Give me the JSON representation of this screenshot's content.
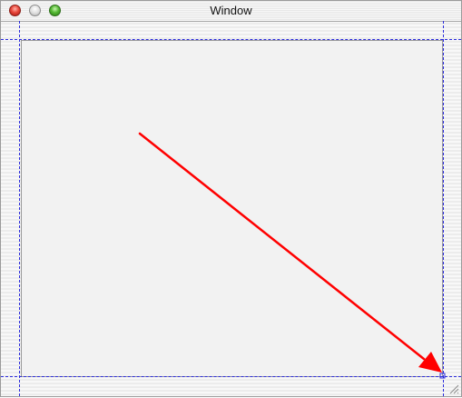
{
  "window": {
    "title": "Window"
  },
  "controls": {
    "close_icon": "close-icon",
    "minimize_icon": "minimize-icon",
    "zoom_icon": "zoom-icon"
  },
  "canvas": {
    "arrow_color": "#ff0000",
    "guide_color": "#2a2adc",
    "background_color": "#f2f2f2"
  }
}
